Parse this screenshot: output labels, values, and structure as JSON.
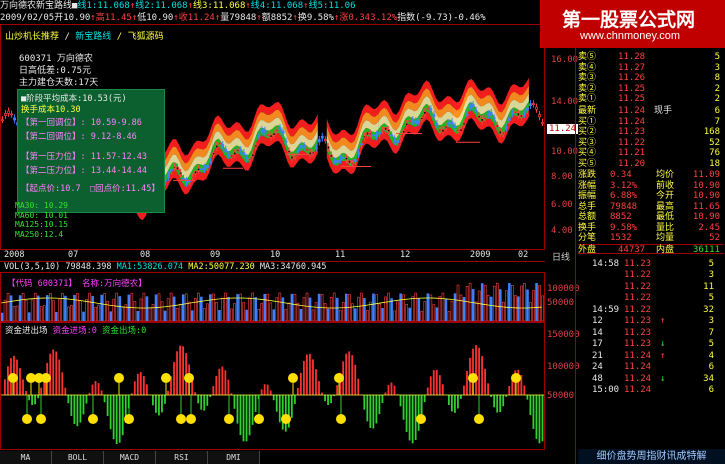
{
  "header": {
    "row1": [
      {
        "text": "万向德农",
        "color": "white"
      },
      {
        "text": "新宝路线",
        "color": "white"
      },
      {
        "text": "■",
        "color": "white"
      },
      {
        "text": "线1:11.068",
        "color": "cyan"
      },
      {
        "text": "↑",
        "color": "red"
      },
      {
        "text": "线2:11.068",
        "color": "cyan"
      },
      {
        "text": "↑",
        "color": "red"
      },
      {
        "text": "线3:11.068",
        "color": "yellow"
      },
      {
        "text": "↑",
        "color": "red"
      },
      {
        "text": "线4:11.068",
        "color": "cyan"
      },
      {
        "text": "↑",
        "color": "red"
      },
      {
        "text": "线5:11.06",
        "color": "cyan"
      }
    ],
    "row2": [
      {
        "text": "2009/02/05",
        "color": "white"
      },
      {
        "text": "开10.90",
        "color": "white"
      },
      {
        "text": "↑",
        "color": "red"
      },
      {
        "text": "高11.45",
        "color": "red"
      },
      {
        "text": "↑",
        "color": "red"
      },
      {
        "text": "低10.90",
        "color": "white"
      },
      {
        "text": "↑",
        "color": "red"
      },
      {
        "text": "收11.24",
        "color": "red"
      },
      {
        "text": "↑",
        "color": "red"
      },
      {
        "text": "量79848",
        "color": "white"
      },
      {
        "text": "↑",
        "color": "red"
      },
      {
        "text": "额8852",
        "color": "white"
      },
      {
        "text": "↑",
        "color": "red"
      },
      {
        "text": "换9.58%",
        "color": "white"
      },
      {
        "text": "↑",
        "color": "red"
      },
      {
        "text": "涨0.34",
        "color": "red"
      },
      {
        "text": "3.12%",
        "color": "red"
      },
      {
        "text": "指数(-9.73)-0.46%",
        "color": "white"
      }
    ],
    "extra_top": [
      "缩",
      "↑",
      "8",
      "↑",
      "启动:0"
    ]
  },
  "toolbar": {
    "label1": "山炒机长推荐",
    "label2": "新宝路线",
    "label3": "飞狐源码"
  },
  "stock_info": {
    "code_name": "600371 万向德农",
    "daily_range": "日高低差:0.75元",
    "main_build_days": "主力建仓天数:17天"
  },
  "info_box": {
    "avg_cost": "■阶段平均成本:10.53(元)",
    "handover_cost": "换手成本10.30",
    "support1": "【第一回调位】: 10.59-9.86",
    "support2": "【第二回调位】: 9.12-8.46",
    "pressure1": "【第一压力位】: 11.57-12.43",
    "pressure2": "【第二压力位】: 13.44-14.44",
    "start_price": "【起点价:10.7",
    "break_price": "□回点价:11.45】",
    "ma30": "MA30: 10.29",
    "ma60": "MA60: 10.01",
    "ma125": "MA125:10.15",
    "ma250": "MA250:12.4"
  },
  "price_axis": [
    "16.00",
    "14.00",
    "12.00",
    "10.00",
    "8.00",
    "6.00",
    "4.00"
  ],
  "current_price_marker": "11.24",
  "date_axis": [
    "2008",
    "07",
    "08",
    "09",
    "10",
    "11",
    "12",
    "2009",
    "02"
  ],
  "date_axis_label": "日线",
  "vol_header": {
    "label": "VOL(3,5,10)",
    "value": "79848.398",
    "ma1": "MA1:53826.074",
    "ma2": "MA2:50077.230",
    "ma3": "MA3:34760.945"
  },
  "vol_sub": {
    "code": "【代码 600371】",
    "name": "名称:万向德农】"
  },
  "vol_axis": [
    "100000",
    "50000"
  ],
  "flow_header": {
    "label": "资金进出场",
    "in": "资金进场:0",
    "out": "资金出场:0"
  },
  "flow_axis": [
    "150000",
    "100000",
    "50000"
  ],
  "bottom_tabs": [
    "MA",
    "BOLL",
    "MACD",
    "RSI",
    "DMI"
  ],
  "chart_data": {
    "type": "line",
    "title": "",
    "ylabel": "",
    "ylim": [
      4,
      16
    ],
    "categories": [
      "2008",
      "07",
      "08",
      "09",
      "10",
      "11",
      "12",
      "2009",
      "02"
    ],
    "series": [
      {
        "name": "收",
        "values": [
          11.0,
          9.0,
          6.5,
          8.5,
          10.0,
          8.8,
          10.8,
          11.0,
          11.24
        ]
      }
    ]
  },
  "logo": {
    "line1": "第一股票公式网",
    "line2": "www.chnmoney.com"
  },
  "quote": {
    "sells": [
      {
        "label": "卖⑤",
        "price": "11.28",
        "vol": "5"
      },
      {
        "label": "卖④",
        "price": "11.27",
        "vol": "3"
      },
      {
        "label": "卖③",
        "price": "11.26",
        "vol": "8"
      },
      {
        "label": "卖②",
        "price": "11.25",
        "vol": "2"
      },
      {
        "label": "卖①",
        "price": "11.25",
        "vol": "2"
      }
    ],
    "latest": {
      "label": "最新",
      "price": "11.24",
      "extra": "现手",
      "vol": "6"
    },
    "buys": [
      {
        "label": "买①",
        "price": "11.24",
        "vol": "7"
      },
      {
        "label": "买②",
        "price": "11.23",
        "vol": "168"
      },
      {
        "label": "买③",
        "price": "11.22",
        "vol": "52"
      },
      {
        "label": "买④",
        "price": "11.21",
        "vol": "76"
      },
      {
        "label": "买⑤",
        "price": "11.20",
        "vol": "18"
      }
    ],
    "summary": [
      {
        "l1": "涨跌",
        "v1": "0.34",
        "l2": "均价",
        "v2": "11.09"
      },
      {
        "l1": "涨幅",
        "v1": "3.12%",
        "l2": "前收",
        "v2": "10.90"
      },
      {
        "l1": "振幅",
        "v1": "6.88%",
        "l2": "今开",
        "v2": "10.90"
      },
      {
        "l1": "总手",
        "v1": "79848",
        "l2": "最高",
        "v2": "11.65"
      },
      {
        "l1": "总额",
        "v1": "8852",
        "l2": "最低",
        "v2": "10.90"
      },
      {
        "l1": "换手",
        "v1": "9.58%",
        "l2": "量比",
        "v2": "2.45"
      },
      {
        "l1": "分笔",
        "v1": "1532",
        "l2": "均量",
        "v2": "52"
      }
    ],
    "outer": {
      "label": "外盘",
      "value": "44737",
      "label2": "内盘",
      "value2": "36111"
    },
    "ticks": [
      {
        "time": "14:58",
        "price": "11.23",
        "arrow": "",
        "vol": "5"
      },
      {
        "time": "",
        "price": "11.22",
        "arrow": "",
        "vol": "3"
      },
      {
        "time": "",
        "price": "11.22",
        "arrow": "",
        "vol": "11"
      },
      {
        "time": "",
        "price": "11.22",
        "arrow": "",
        "vol": "5"
      },
      {
        "time": "14:59",
        "price": "11.22",
        "arrow": "",
        "vol": "32"
      },
      {
        "time": "12",
        "price": "11.23",
        "arrow": "↑",
        "vol": "3"
      },
      {
        "time": "14",
        "price": "11.23",
        "arrow": "",
        "vol": "7"
      },
      {
        "time": "17",
        "price": "11.23",
        "arrow": "↓",
        "vol": "5"
      },
      {
        "time": "21",
        "price": "11.24",
        "arrow": "↑",
        "vol": "4"
      },
      {
        "time": "24",
        "price": "11.24",
        "arrow": "",
        "vol": "6"
      },
      {
        "time": "48",
        "price": "11.24",
        "arrow": "↓",
        "vol": "34"
      },
      {
        "time": "15:00",
        "price": "11.24",
        "arrow": "",
        "vol": "6"
      }
    ]
  },
  "bottom_ad": "细价盘势周指财讯成特解",
  "colors": {
    "up": "#ff4040",
    "down": "#30e030",
    "frame": "#a00000",
    "blue": "#4080ff"
  }
}
